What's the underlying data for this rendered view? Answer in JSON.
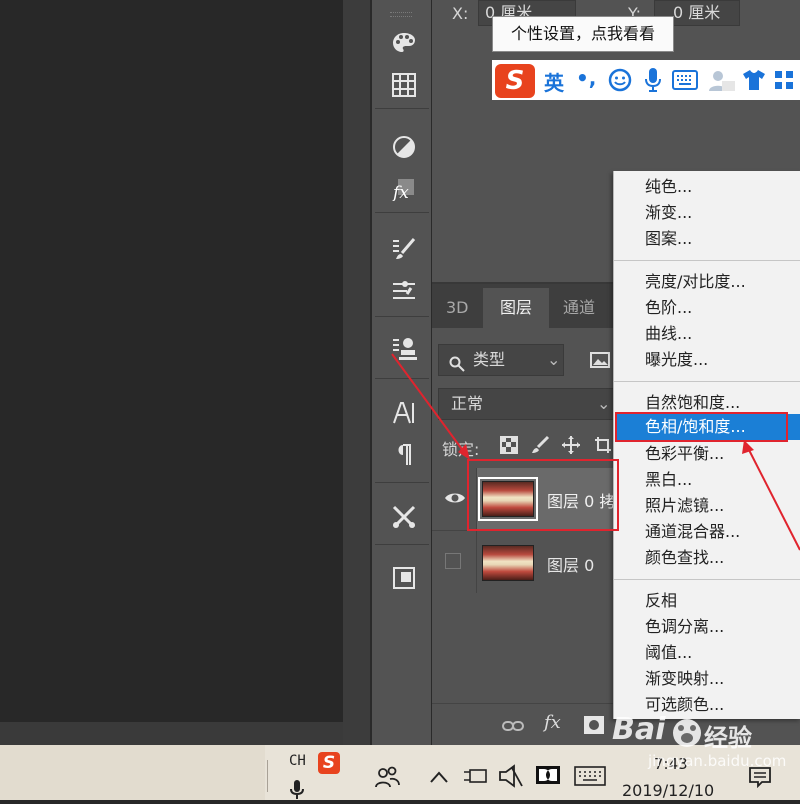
{
  "properties": {
    "x_label": "X:",
    "x_value": "0 厘米",
    "y_label": "Y:",
    "y_value": "0 厘米"
  },
  "tooltip": {
    "text": "个性设置，点我看看"
  },
  "ime": {
    "logo": "S",
    "mode": "英",
    "punct": "•,"
  },
  "layers_panel": {
    "tabs": [
      {
        "label": "3D"
      },
      {
        "label": "图层"
      },
      {
        "label": "通道"
      }
    ],
    "filter_kind": "类型",
    "blend_mode": "正常",
    "lock_label": "锁定:",
    "layers": [
      {
        "name": "图层 0 拷",
        "visible": true
      },
      {
        "name": "图层 0",
        "visible": false
      }
    ],
    "footer_fx": "fx"
  },
  "menu": {
    "groups": [
      {
        "items": [
          "纯色...",
          "渐变...",
          "图案..."
        ]
      },
      {
        "items": [
          "亮度/对比度...",
          "色阶...",
          "曲线...",
          "曝光度..."
        ]
      },
      {
        "items": [
          "自然饱和度...",
          "色相/饱和度...",
          "色彩平衡...",
          "黑白...",
          "照片滤镜...",
          "通道混合器...",
          "颜色查找..."
        ]
      },
      {
        "items": [
          "反相",
          "色调分离...",
          "阈值...",
          "渐变映射...",
          "可选颜色..."
        ]
      }
    ],
    "highlighted": "色相/饱和度..."
  },
  "taskbar": {
    "lang": "CH",
    "time": "7:43",
    "date": "2019/12/10"
  },
  "watermark": {
    "brand": "Bai",
    "brand2": "经验",
    "url": "jingyan.baidu.com"
  },
  "colors": {
    "accent_highlight": "#1b7fd6",
    "annotation_red": "#e0242e",
    "panel_bg": "#535353"
  }
}
